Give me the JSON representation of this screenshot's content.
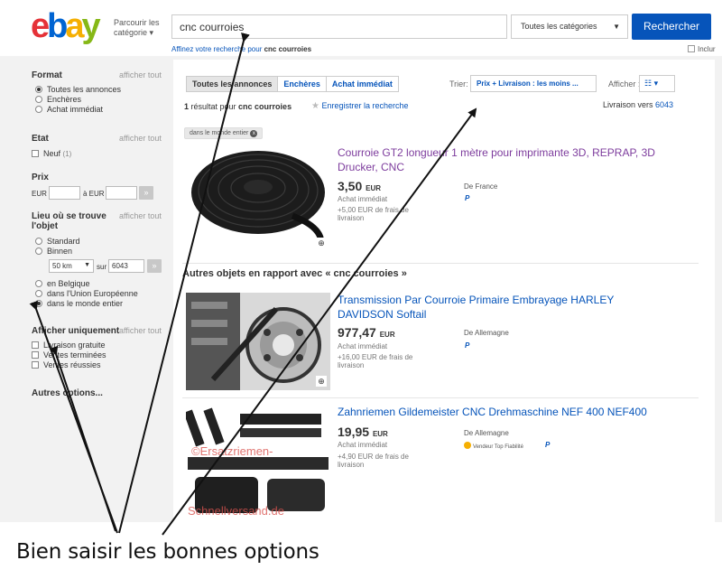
{
  "header": {
    "logo": {
      "e": "e",
      "b": "b",
      "a": "a",
      "y": "y"
    },
    "browse_line1": "Parcourir les",
    "browse_line2": "catégorie ▾",
    "search_value": "cnc courroies",
    "category_select": "Toutes les catégories",
    "search_button": "Rechercher",
    "refine_prefix": "Affinez votre recherche pour ",
    "refine_term": "cnc courroies",
    "include_label": "Inclur"
  },
  "sidebar": {
    "format": {
      "title": "Format",
      "show_all": "afficher tout",
      "options": [
        "Toutes les annonces",
        "Enchères",
        "Achat immédiat"
      ]
    },
    "etat": {
      "title": "Etat",
      "show_all": "afficher tout",
      "new_label": "Neuf",
      "new_count": "(1)"
    },
    "prix": {
      "title": "Prix",
      "from_label": "EUR",
      "to_label": "à EUR",
      "go": "»"
    },
    "lieu": {
      "title_line1": "Lieu où se trouve",
      "title_line2": "l'objet",
      "show_all": "afficher tout",
      "standard": "Standard",
      "binnen": "Binnen",
      "distance": "50 km",
      "sur": "sur",
      "postcode": "6043",
      "go": "»",
      "belgique": "en Belgique",
      "ue": "dans l'Union Européenne",
      "monde": "dans le monde entier"
    },
    "afficher": {
      "title": "Afficher uniquement",
      "show_all": "afficher tout",
      "options": [
        "Livraison gratuite",
        "Ventes terminées",
        "Ventes réussies"
      ]
    },
    "more": "Autres options..."
  },
  "main": {
    "tabs": [
      "Toutes les annonces",
      "Enchères",
      "Achat immédiat"
    ],
    "sort_label": "Trier:",
    "sort_value": "Prix + Livraison : les moins ...",
    "show_label": "Afficher :",
    "view_icon": "☷ ▾",
    "result_count": "1",
    "result_text": " résultat pour ",
    "result_term": "cnc courroies",
    "save_search": "Enregistrer la recherche",
    "delivery_label": "Livraison vers ",
    "delivery_code": "6043",
    "chip": "dans le monde entier",
    "chip_x": "x",
    "related_heading": "Autres objets en rapport avec « cnc courroies »",
    "items": [
      {
        "title": "Courroie GT2 longueur 1 mètre pour imprimante 3D, REPRAP, 3D Drucker, CNC",
        "price": "3,50",
        "currency": "EUR",
        "type": "Achat immédiat",
        "shipping": "+5,00 EUR de frais de livraison",
        "from": "De France",
        "paypal": "P"
      },
      {
        "title": "Transmission Par Courroie Primaire Embrayage HARLEY DAVIDSON Softail",
        "price": "977,47",
        "currency": "EUR",
        "type": "Achat immédiat",
        "shipping": "+16,00 EUR de frais de livraison",
        "from": "De Allemagne",
        "paypal": "P"
      },
      {
        "title": "Zahnriemen Gildemeister CNC Drehmaschine NEF 400 NEF400",
        "price": "19,95",
        "currency": "EUR",
        "type": "Achat immédiat",
        "shipping": "+4,90 EUR de frais de livraison",
        "from": "De Allemagne",
        "top_seller": "Vendeur Top Fiabilité",
        "paypal": "P",
        "watermark1": "©Ersatzriemen-",
        "watermark2": "Schnellversand.de"
      }
    ],
    "zoom_icon": "⊕"
  },
  "caption": "Bien saisir les bonnes options",
  "colors": {
    "accent": "#0654ba",
    "visited": "#7d3c9d",
    "arrow": "#111111"
  }
}
